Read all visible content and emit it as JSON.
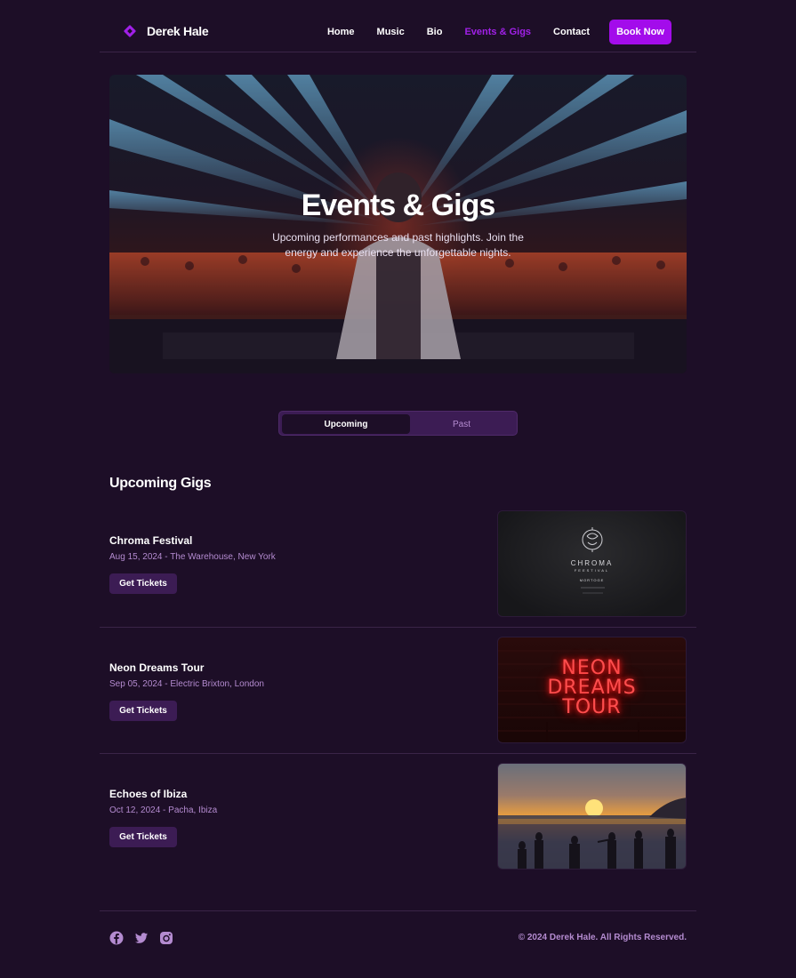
{
  "brand": {
    "name": "Derek Hale"
  },
  "nav": {
    "links": [
      "Home",
      "Music",
      "Bio",
      "Events & Gigs",
      "Contact"
    ],
    "active": "Events & Gigs",
    "cta": "Book Now"
  },
  "hero": {
    "title": "Events & Gigs",
    "subtitle": "Upcoming performances and past highlights. Join the energy and experience the unforgettable nights."
  },
  "tabs": [
    "Upcoming",
    "Past"
  ],
  "section_title": "Upcoming Gigs",
  "gigs": [
    {
      "name": "Chroma Festival",
      "meta": "Aug 15, 2024 - The Warehouse, New York",
      "button": "Get Tickets"
    },
    {
      "name": "Neon Dreams Tour",
      "meta": "Sep 05, 2024 - Electric Brixton, London",
      "button": "Get Tickets"
    },
    {
      "name": "Echoes of Ibiza",
      "meta": "Oct 12, 2024 - Pacha, Ibiza",
      "button": "Get Tickets"
    }
  ],
  "poster_text": {
    "chroma": {
      "title": "CHROMA",
      "subtitle": "FEESTIVAL",
      "tag": "MORTOGE"
    },
    "neon": [
      "NEON",
      "DREAMS",
      "TOUR"
    ]
  },
  "footer": {
    "copyright": "© 2024 Derek Hale. All Rights Reserved.",
    "social_icons": [
      "facebook-icon",
      "twitter-icon",
      "instagram-icon"
    ]
  },
  "colors": {
    "accent": "#a30ceb",
    "background": "#1d0e27",
    "muted": "#b48bd0",
    "pill": "#3c1c54"
  }
}
